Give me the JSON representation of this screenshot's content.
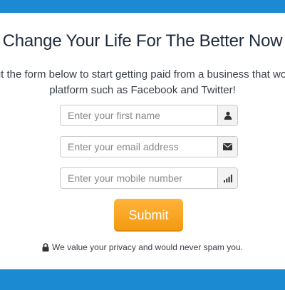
{
  "headline": "Change Your Life For The Better Now",
  "subline": {
    "line1": "ut the form below to start getting paid from a business that wor",
    "line2": "platform such as Facebook and Twitter!"
  },
  "form": {
    "first_name_placeholder": "Enter your first name",
    "email_placeholder": "Enter your email address",
    "mobile_placeholder": "Enter your mobile number",
    "submit_label": "Submit"
  },
  "privacy_text": "We value your privacy and would never spam you.",
  "icons": {
    "first_name": "user-icon",
    "email": "envelope-icon",
    "mobile": "signal-icon",
    "privacy": "lock-icon"
  },
  "colors": {
    "bar": "#1b8ad3",
    "headline": "#1f2a3d",
    "button": "#f5a21e"
  }
}
